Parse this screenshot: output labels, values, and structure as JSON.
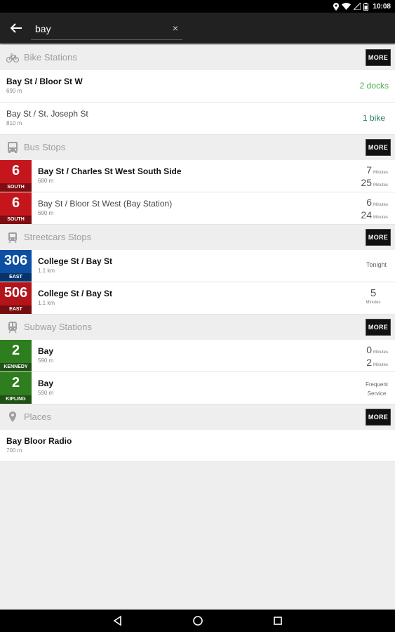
{
  "status": {
    "time": "10:08"
  },
  "search": {
    "value": "bay",
    "clear_glyph": "×"
  },
  "sections": {
    "bike": {
      "title": "Bike Stations",
      "more": "MORE",
      "icon": "bicycle-icon"
    },
    "bus": {
      "title": "Bus Stops",
      "more": "MORE",
      "icon": "bus-icon"
    },
    "streetcar": {
      "title": "Streetcars Stops",
      "more": "MORE",
      "icon": "streetcar-icon"
    },
    "subway": {
      "title": "Subway Stations",
      "more": "MORE",
      "icon": "subway-icon"
    },
    "places": {
      "title": "Places",
      "more": "MORE",
      "icon": "location-pin-icon"
    }
  },
  "bike_rows": [
    {
      "name": "Bay St / Bloor St W",
      "distance": "690 m",
      "availability": "2 docks"
    },
    {
      "name": "Bay St / St. Joseph St",
      "distance": "810 m",
      "availability": "1 bike"
    }
  ],
  "bus_rows": [
    {
      "route": "6",
      "direction": "SOUTH",
      "name": "Bay St / Charles St West South Side",
      "distance": "680 m",
      "eta1": "7",
      "eta1_unit": "Minutes",
      "eta2": "25",
      "eta2_unit": "Minutes",
      "color": "#c4161c"
    },
    {
      "route": "6",
      "direction": "SOUTH",
      "name": "Bay St / Bloor St West (Bay Station)",
      "distance": "690 m",
      "eta1": "6",
      "eta1_unit": "Minutes",
      "eta2": "24",
      "eta2_unit": "Minutes",
      "color": "#c4161c"
    }
  ],
  "streetcar_rows": [
    {
      "route": "306",
      "direction": "EAST",
      "name": "College St / Bay St",
      "distance": "1.1 km",
      "eta_text": "Tonight",
      "color": "#0d4fa3"
    },
    {
      "route": "506",
      "direction": "EAST",
      "name": "College St / Bay St",
      "distance": "1.1 km",
      "eta": "5",
      "eta_unit": "Minutes",
      "color": "#b3141a"
    }
  ],
  "subway_rows": [
    {
      "route": "2",
      "direction": "KENNEDY",
      "name": "Bay",
      "distance": "590 m",
      "eta1": "0",
      "eta1_unit": "Minutes",
      "eta2": "2",
      "eta2_unit": "Minutes",
      "color": "#2e7d1e"
    },
    {
      "route": "2",
      "direction": "KIPLING",
      "name": "Bay",
      "distance": "590 m",
      "eta_line1": "Frequent",
      "eta_line2": "Service",
      "color": "#2e7d1e"
    }
  ],
  "place_rows": [
    {
      "name": "Bay Bloor Radio",
      "distance": "700 m"
    }
  ]
}
